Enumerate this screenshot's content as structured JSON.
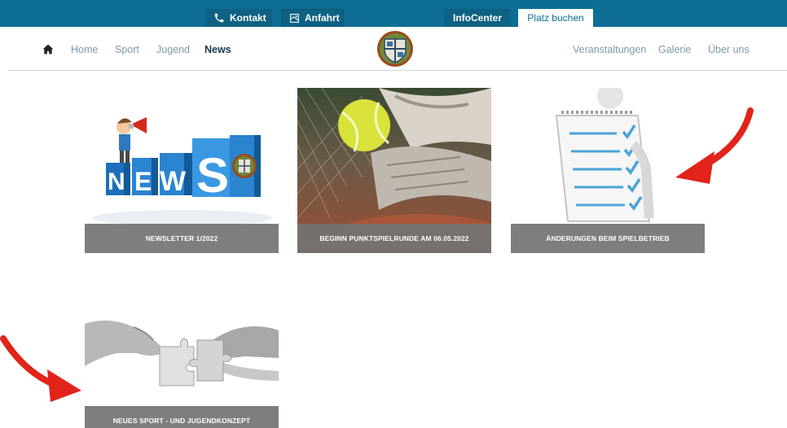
{
  "topbar": {
    "kontakt": "Kontakt",
    "anfahrt": "Anfahrt",
    "infocenter": "InfoCenter",
    "platz_buchen": "Platz buchen"
  },
  "nav": {
    "home_icon": "home-icon",
    "left": [
      "Home",
      "Sport",
      "Jugend",
      "News"
    ],
    "active": "News",
    "right": [
      "Veranstaltungen",
      "Galerie",
      "Über uns"
    ]
  },
  "cards": [
    {
      "title": "NEWSLETTER 1/2022",
      "image": "news-megaphone-illustration"
    },
    {
      "title": "BEGINN PUNKTSPIELRUNDE AM 06.05.2022",
      "image": "tennis-ball-shoe-photo"
    },
    {
      "title": "ÄNDERUNGEN BEIM SPIELBETRIEB",
      "image": "checklist-figure-illustration"
    },
    {
      "title": "NEUES SPORT - UND JUGENDKONZEPT",
      "image": "puzzle-hands-photo"
    }
  ],
  "news_graphic": {
    "letters": [
      "N",
      "E",
      "W",
      "S"
    ]
  },
  "colors": {
    "topbar": "#0d6d94",
    "caption": "#737373",
    "arrow": "#e2231a",
    "nav_link": "#7a9aa8",
    "nav_active": "#123a4a"
  }
}
